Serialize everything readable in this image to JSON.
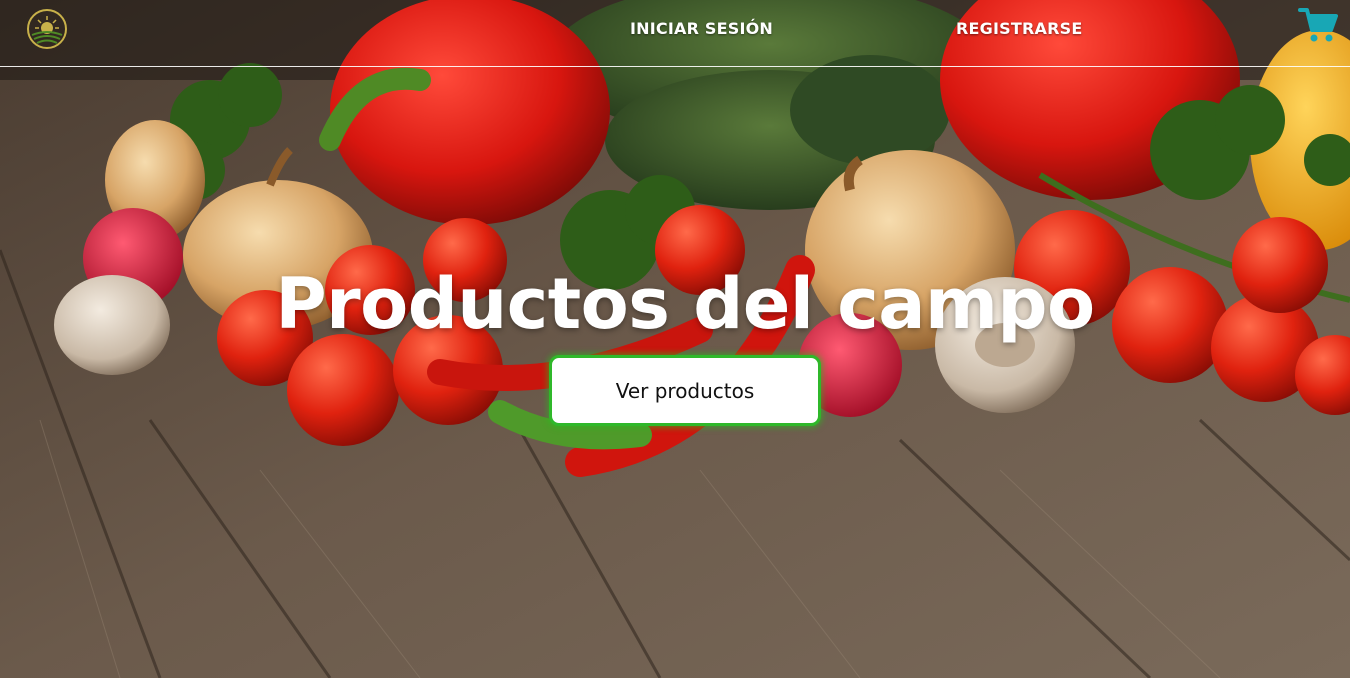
{
  "nav": {
    "login_label": "INICIAR SESIÓN",
    "register_label": "REGISTRARSE",
    "cart_icon": "shopping-cart-icon",
    "logo_icon": "sun-over-field-logo"
  },
  "hero": {
    "title": "Productos del campo",
    "button_label": "Ver productos",
    "background": "vegetables-on-wooden-table-photo"
  },
  "colors": {
    "cart": "#18a7b5",
    "button_border": "#2fb82a",
    "logo": "#c8b14a"
  }
}
